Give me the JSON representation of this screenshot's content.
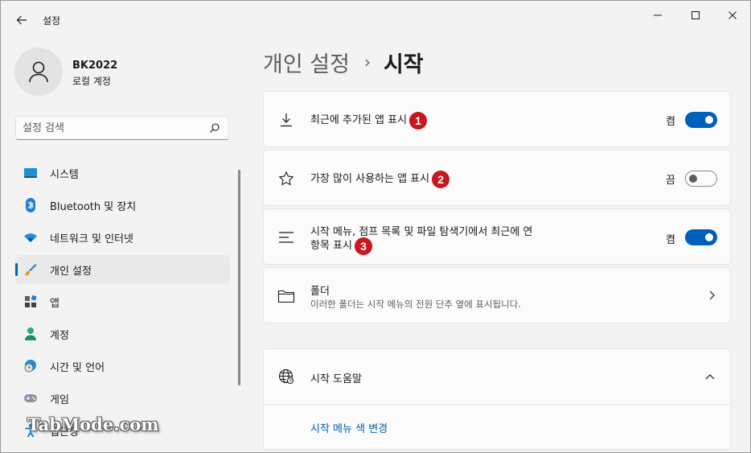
{
  "titlebar": {
    "app_title": "설정",
    "back_icon": "arrow-left-icon",
    "minimize_icon": "minimize-icon",
    "maximize_icon": "maximize-icon",
    "close_icon": "close-icon"
  },
  "profile": {
    "name": "BK2022",
    "account_type": "로컬 계정",
    "avatar_icon": "person-icon"
  },
  "search": {
    "placeholder": "설정 검색",
    "icon": "search-icon"
  },
  "sidebar": {
    "items": [
      {
        "label": "시스템",
        "icon": "system-icon",
        "active": false
      },
      {
        "label": "Bluetooth 및 장치",
        "icon": "bluetooth-icon",
        "active": false
      },
      {
        "label": "네트워크 및 인터넷",
        "icon": "wifi-icon",
        "active": false
      },
      {
        "label": "개인 설정",
        "icon": "brush-icon",
        "active": true
      },
      {
        "label": "앱",
        "icon": "apps-icon",
        "active": false
      },
      {
        "label": "계정",
        "icon": "account-icon",
        "active": false
      },
      {
        "label": "시간 및 언어",
        "icon": "globe-clock-icon",
        "active": false
      },
      {
        "label": "게임",
        "icon": "gamepad-icon",
        "active": false
      },
      {
        "label": "접근성",
        "icon": "accessibility-icon",
        "active": false
      }
    ]
  },
  "header": {
    "parent": "개인 설정",
    "separator": "›",
    "current": "시작"
  },
  "settings": [
    {
      "title": "최근에 추가된 앱 표시",
      "badge": "1",
      "state_label": "켬",
      "on": true,
      "icon": "download-icon"
    },
    {
      "title": "가장 많이 사용하는 앱 표시",
      "badge": "2",
      "state_label": "끔",
      "on": false,
      "icon": "star-icon"
    },
    {
      "title_line1": "시작 메뉴, 점프 목록 및 파일 탐색기에서 최근에 연",
      "title_line2": "항목 표시",
      "badge": "3",
      "state_label": "켬",
      "on": true,
      "icon": "list-icon"
    }
  ],
  "folders": {
    "title": "폴더",
    "subtitle": "이러한 폴더는 시작 메뉴의 전원 단추 옆에 표시됩니다.",
    "icon": "folder-icon",
    "chevron": "chevron-right-icon"
  },
  "help": {
    "title": "시작 도움말",
    "icon": "globe-icon",
    "chevron": "chevron-up-icon",
    "link": "시작 메뉴 색 변경"
  },
  "watermark": "TabMode.com",
  "colors": {
    "accent": "#005fb8",
    "badge": "#c8171e",
    "background": "#f3f3f3",
    "card": "#fbfbfb"
  }
}
